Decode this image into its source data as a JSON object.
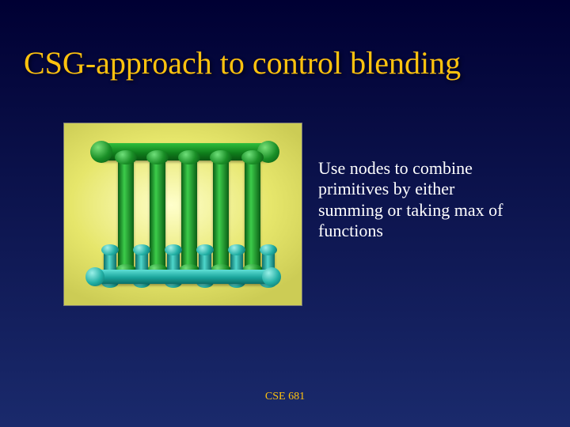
{
  "title": "CSG-approach to control blending",
  "body": "Use nodes to combine primitives by either summing or taking max of functions",
  "footer": "CSE 681"
}
